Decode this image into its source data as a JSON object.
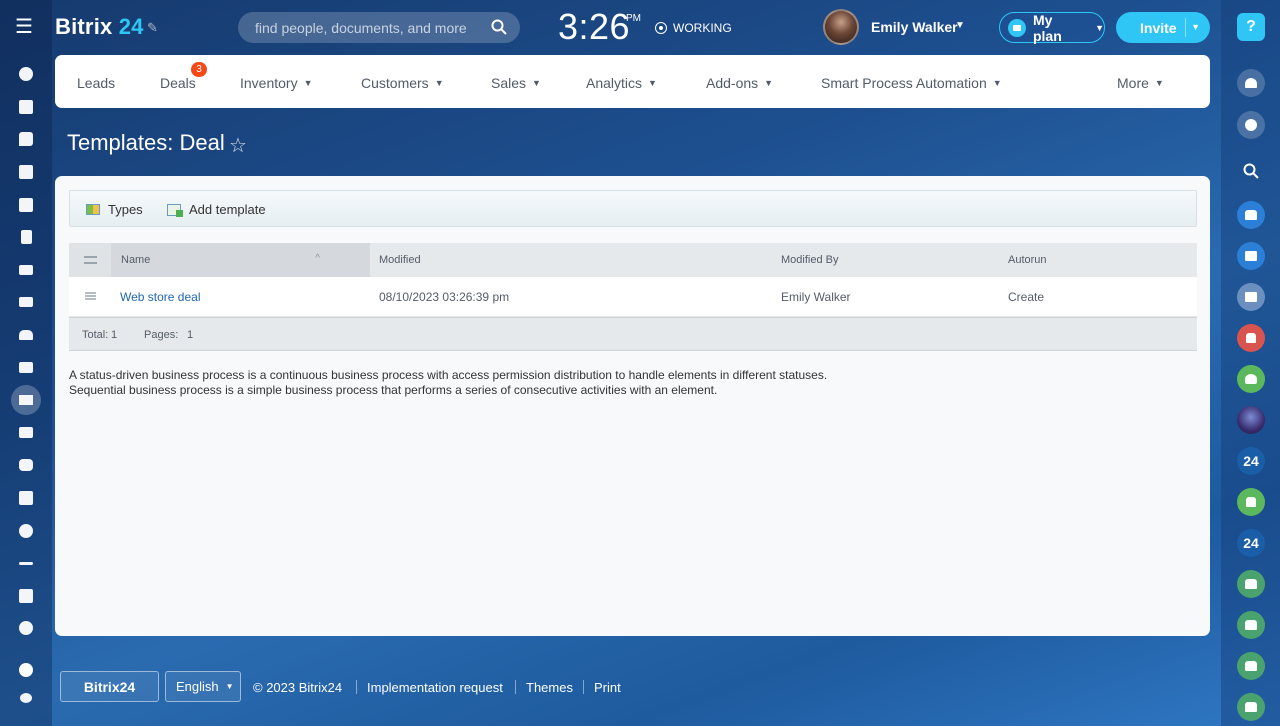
{
  "header": {
    "logo_brand": "Bitrix",
    "logo_num": "24",
    "search_placeholder": "find people, documents, and more",
    "clock": "3:26",
    "clock_ampm": "PM",
    "working_status": "WORKING",
    "user_name": "Emily Walker",
    "myplan_label": "My plan",
    "invite_label": "Invite"
  },
  "nav": {
    "items": [
      {
        "label": "Leads",
        "dropdown": false
      },
      {
        "label": "Deals",
        "dropdown": false
      },
      {
        "label": "Inventory",
        "dropdown": true
      },
      {
        "label": "Customers",
        "dropdown": true
      },
      {
        "label": "Sales",
        "dropdown": true
      },
      {
        "label": "Analytics",
        "dropdown": true
      },
      {
        "label": "Add-ons",
        "dropdown": true
      },
      {
        "label": "Smart Process Automation",
        "dropdown": true
      },
      {
        "label": "More",
        "dropdown": true
      }
    ],
    "deals_badge": "3"
  },
  "page": {
    "title": "Templates: Deal"
  },
  "toolbar": {
    "types_label": "Types",
    "add_template_label": "Add template"
  },
  "grid": {
    "columns": [
      "Name",
      "Modified",
      "Modified By",
      "Autorun"
    ],
    "rows": [
      {
        "name": "Web store deal",
        "modified": "08/10/2023 03:26:39 pm",
        "modified_by": "Emily Walker",
        "autorun": "Create"
      }
    ],
    "footer": {
      "total_label": "Total:",
      "total_value": "1",
      "pages_label": "Pages:",
      "pages_value": "1"
    }
  },
  "description": {
    "line1": "A status-driven business process is a continuous business process with access permission distribution to handle elements in different statuses.",
    "line2": "Sequential business process is a simple business process that performs a series of consecutive activities with an element."
  },
  "footer": {
    "logo": "Bitrix24",
    "language": "English",
    "copyright": "© 2023 Bitrix24",
    "links": [
      "Implementation request",
      "Themes",
      "Print"
    ]
  },
  "right_bar": {
    "badges": [
      "24",
      "24"
    ]
  },
  "colors": {
    "accent": "#2fc6f6",
    "link": "#2067b0",
    "badge": "#f54819"
  }
}
